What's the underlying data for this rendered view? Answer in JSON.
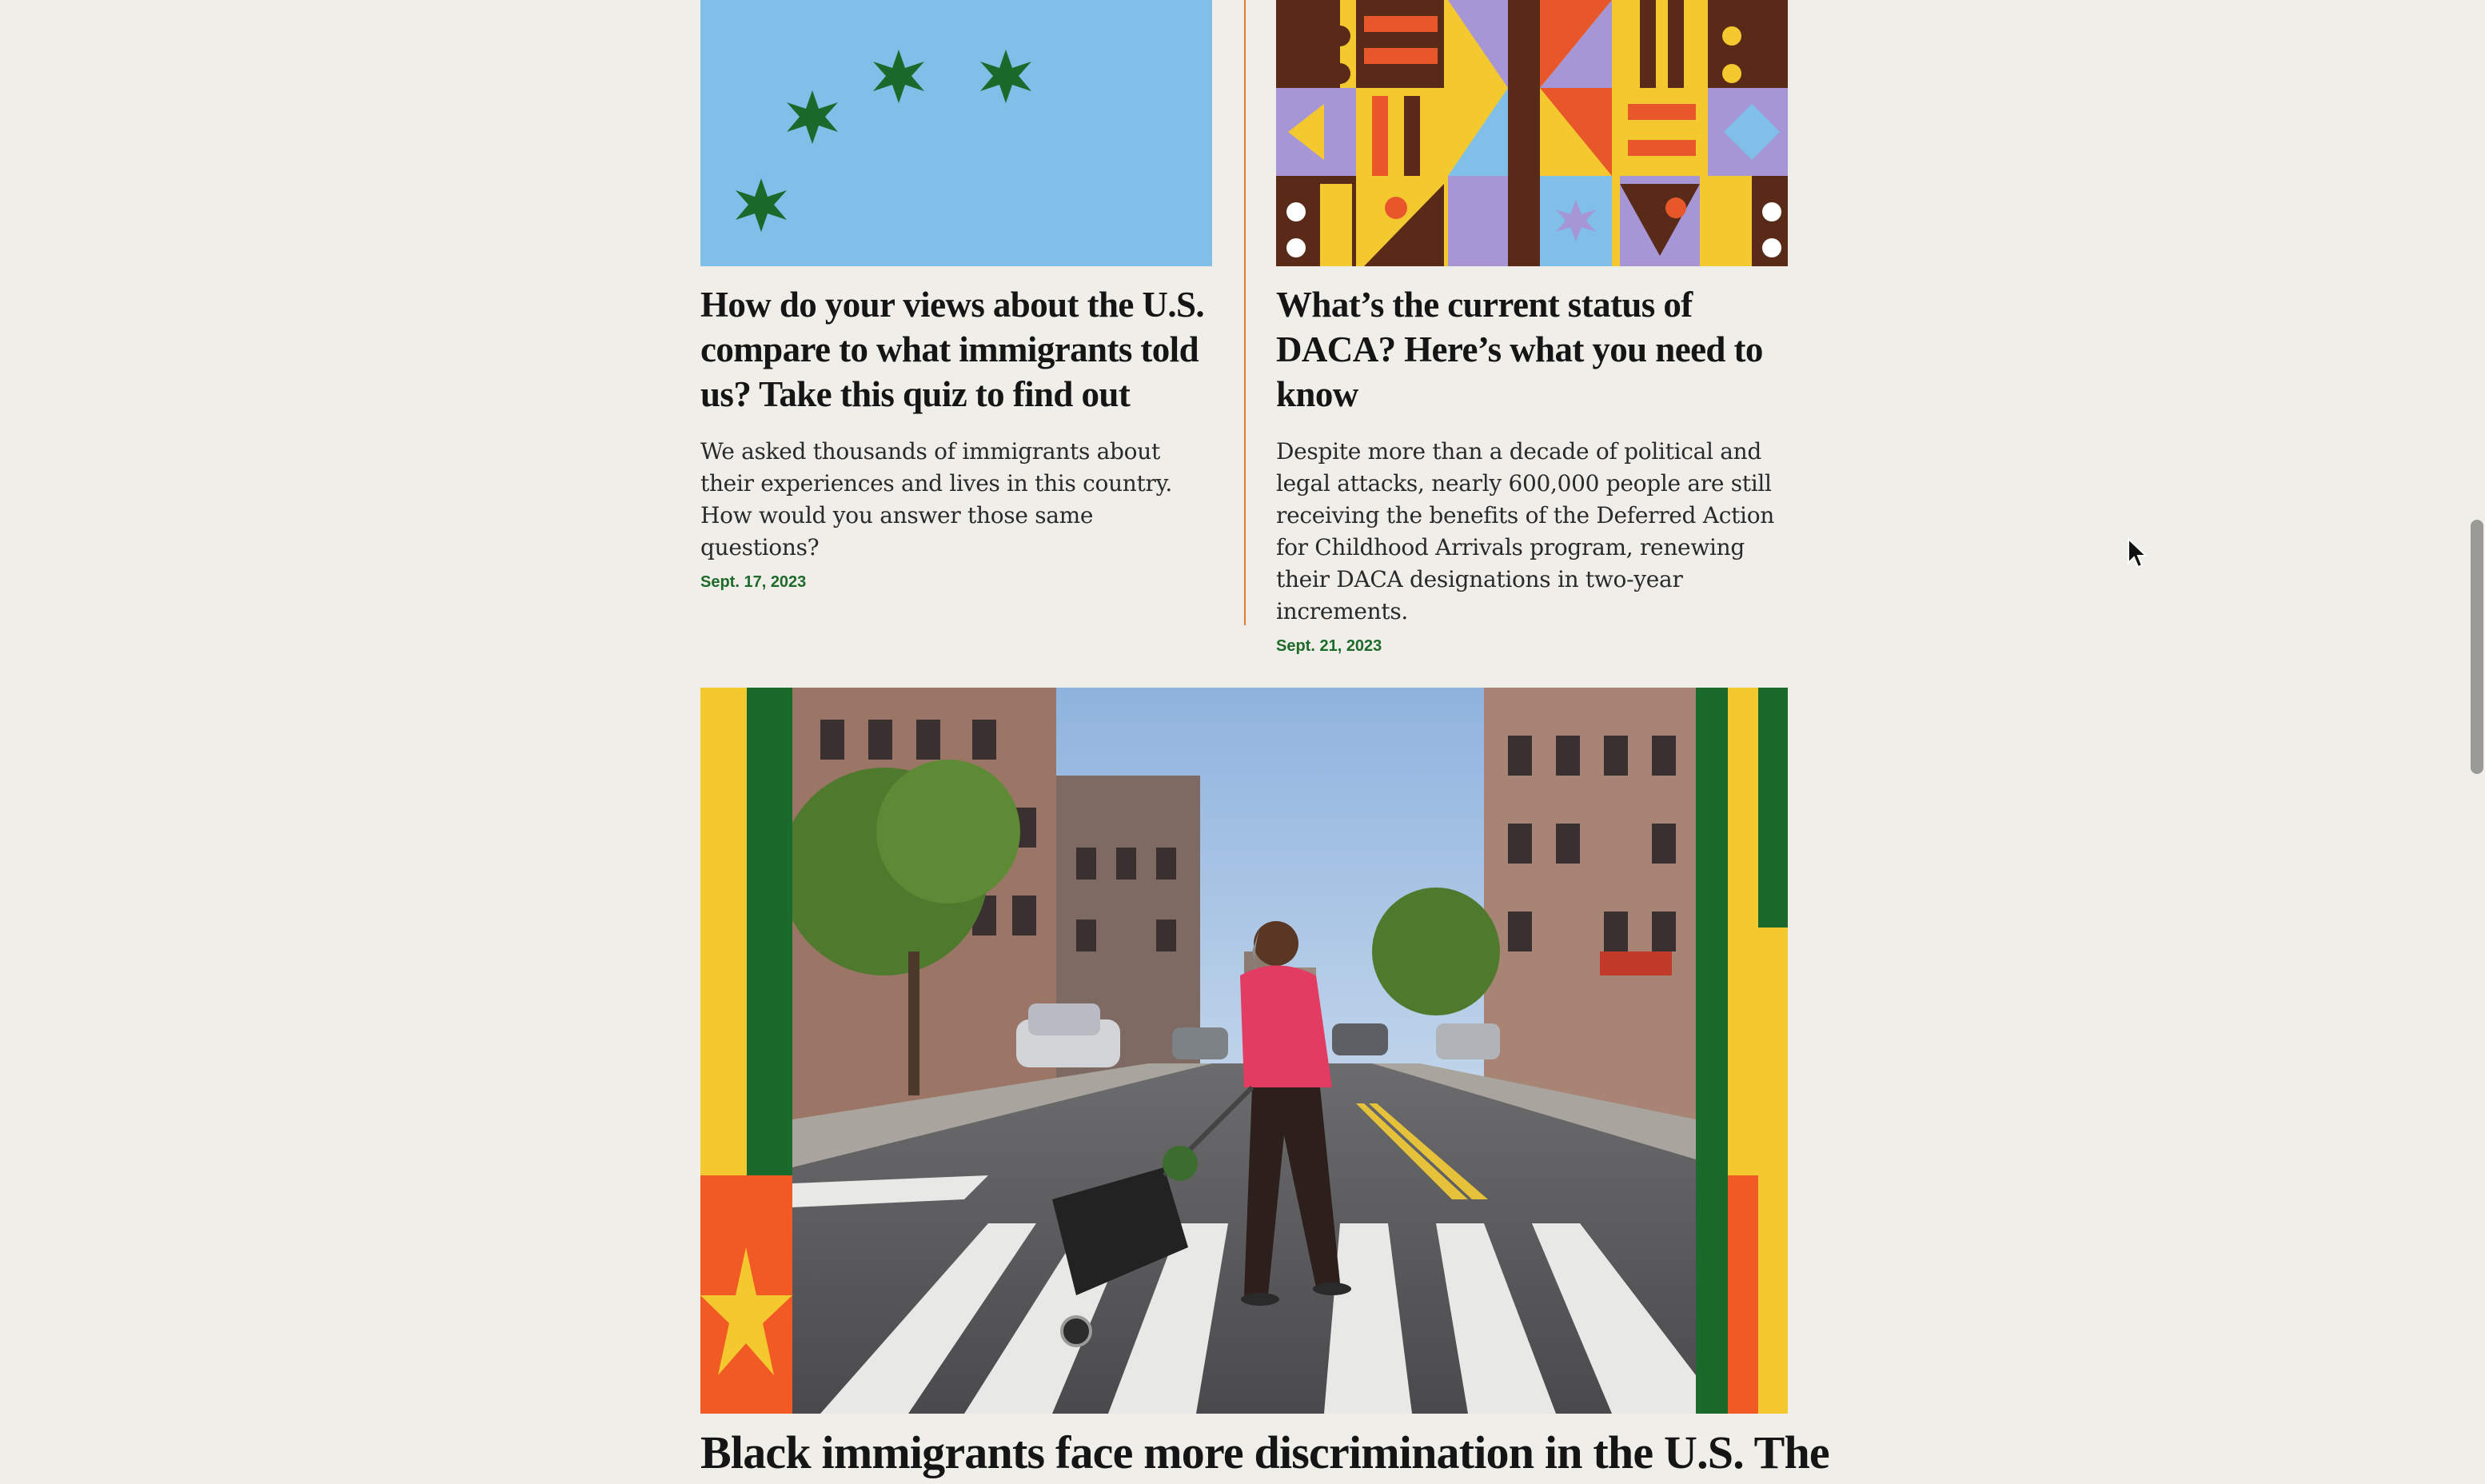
{
  "articles": [
    {
      "headline": "How do your views about the U.S. compare to what immigrants told us? Take this quiz to find out",
      "dek": "We asked thousands of immigrants about their experiences and lives in this country. How would you answer those same questions?",
      "date": "Sept. 17, 2023",
      "image_icon": "stars-illustration"
    },
    {
      "headline": "What’s the current status of DACA? Here’s what you need to know",
      "dek": "Despite more than a decade of political and legal attacks, nearly 600,000 people are still receiving the benefits of the Deferred Action for Childhood Arrivals program, renewing their DACA designations in two-year increments.",
      "date": "Sept. 21, 2023",
      "image_icon": "geometric-pattern-illustration"
    }
  ],
  "feature": {
    "title": "Black immigrants face more discrimination in the U.S. The",
    "image_icon": "street-crosswalk-photo"
  },
  "colors": {
    "background": "#efeee9",
    "date_green": "#1f6a2a",
    "divider_orange": "#e07a3a"
  }
}
